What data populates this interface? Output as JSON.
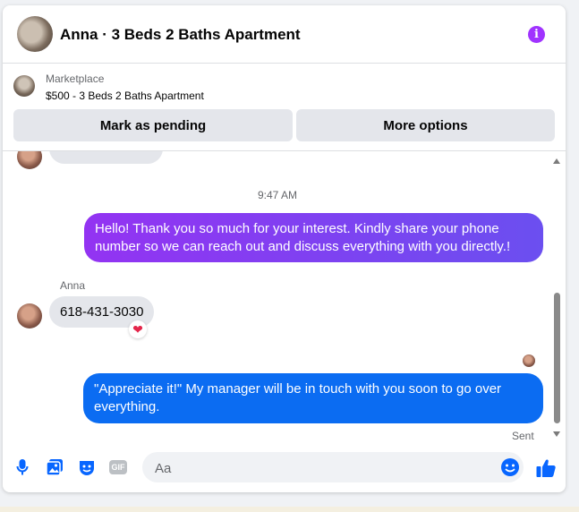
{
  "header": {
    "title": "Anna · 3 Beds 2 Baths Apartment",
    "info_icon_glyph": "i"
  },
  "listing": {
    "source": "Marketplace",
    "name": "$500 - 3 Beds 2 Baths Apartment"
  },
  "actions": {
    "mark_pending": "Mark as pending",
    "more_options": "More options"
  },
  "thread": {
    "timestamp": "9:47 AM",
    "messages": [
      {
        "from": "me",
        "text": "Hello! Thank you so much for your interest. Kindly share your phone number so we can reach out and discuss everything with you directly.!"
      },
      {
        "from": "Anna",
        "sender_label": "Anna",
        "text": "618-431-3030",
        "reaction": "❤"
      },
      {
        "from": "me",
        "text": "\"Appreciate it!\" My manager will be in touch with you soon to go over everything.",
        "status": "Sent"
      }
    ]
  },
  "composer": {
    "placeholder": "Aa",
    "gif_label": "GIF"
  },
  "icons": [
    "info-icon",
    "mic-icon",
    "photo-icon",
    "sticker-icon",
    "gif-icon",
    "emoji-icon",
    "like-icon"
  ],
  "colors": {
    "accent_blue": "#0b6cf2",
    "gradient_purple": "#9333f2",
    "info_purple": "#a033ff",
    "heart_red": "#e4254a"
  }
}
